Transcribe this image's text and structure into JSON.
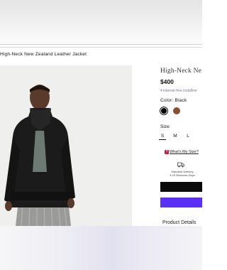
{
  "page": {
    "breadcrumb_title": "High-Neck New Zealand Leather Jacket"
  },
  "product": {
    "title": "High-Neck Ne",
    "price": "$400",
    "installments": "4 interest-free installme",
    "color_label": "Color: Black",
    "colors": [
      {
        "name": "Black",
        "hex": "#000000",
        "selected": true
      },
      {
        "name": "Brown",
        "hex": "#8a4f2c",
        "selected": false
      }
    ],
    "size_label": "Size:",
    "sizes": [
      "S",
      "M",
      "L"
    ],
    "selected_size": "S",
    "size_help": "What's My Size?",
    "delivery_line1": "Standard Delivery",
    "delivery_line2": "4-15 Business Days",
    "details_label": "Product Details"
  },
  "colors": {
    "accent_purple": "#5a31f4",
    "button_black": "#0a0a0a",
    "size_help_icon": "#c0203a"
  },
  "icons": [
    "truck-icon",
    "size-help-icon",
    "photo-placeholder"
  ]
}
